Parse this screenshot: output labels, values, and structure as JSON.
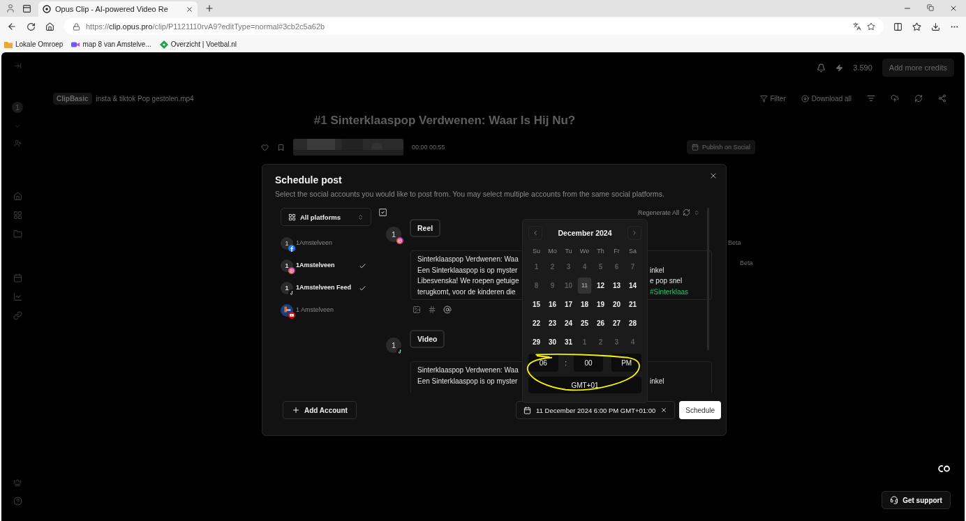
{
  "browser": {
    "tab_title": "Opus Clip - AI-powered Video Re",
    "url_scheme": "https://",
    "url_host": "clip.opus.pro",
    "url_path": "/clip/P1121110rvA9?editType=normal#3cb2c5a62b",
    "bookmarks": [
      {
        "label": "Lokale Omroep",
        "kind": "folder"
      },
      {
        "label": "map 8 van Amstelve...",
        "kind": "video"
      },
      {
        "label": "Overzicht | Voetbal.nl",
        "kind": "diamond"
      }
    ]
  },
  "app": {
    "credits": "3.590",
    "add_credits": "Add more credits",
    "project_count": "1",
    "plan": "ClipBasic",
    "filename": "insta & tiktok Pop gestolen.mp4",
    "filter": "Filter",
    "download_all": "Download all",
    "clip_number": "#1",
    "clip_title": "Sinterklaaspop Verdwenen: Waar Is Hij Nu?",
    "video_time": "00:00",
    "video_duration": "00:55",
    "publish": "Publish on Social",
    "beta_tags": [
      "Beta",
      "Beta"
    ],
    "support": "Get support"
  },
  "schedule": {
    "title": "Schedule post",
    "subtitle": "Select the social accounts you would like to post from. You may select multiple accounts from the same social platforms.",
    "platform_filter": "All platforms",
    "accounts": [
      {
        "name": "1Amstelveen",
        "avatar": "1",
        "kind": "facebook",
        "checked": false
      },
      {
        "name": "1Amstelveen",
        "avatar": "1",
        "kind": "instagram",
        "checked": true
      },
      {
        "name": "1Amstelveen Feed",
        "avatar": "1",
        "kind": "tiktok",
        "checked": true
      },
      {
        "name": "1 Amstelveen",
        "kind": "youtube",
        "checked": false
      }
    ],
    "regenerate": "Regenerate All",
    "posts": [
      {
        "avatar": "1",
        "kind": "instagram",
        "type": "Reel",
        "tools": true,
        "lines": [
          {
            "left": "Sinterklaaspop Verdwenen: Waa"
          },
          {
            "left": "Een Sinterklaaspop is op myster",
            "right": "inkel",
            "hashtag": false
          },
          {
            "left": "Libesvenska! We roepen getuige",
            "right": "e pop snel",
            "hashtag": false
          },
          {
            "left": "terugkomt, voor de kinderen die",
            "right": "#Sinterklaas",
            "hashtag": true
          }
        ]
      },
      {
        "avatar": "1",
        "kind": "tiktok",
        "type": "Video",
        "tools": false,
        "lines": [
          {
            "left": "Sinterklaaspop Verdwenen: Waa"
          },
          {
            "left": "Een Sinterklaaspop is op myster",
            "right": "inkel",
            "hashtag": false
          }
        ]
      }
    ],
    "calendar": {
      "month": "December 2024",
      "weekdays": [
        "Su",
        "Mo",
        "Tu",
        "We",
        "Th",
        "Fr",
        "Sa"
      ],
      "days": [
        {
          "label": "1",
          "muted": true,
          "selected": false
        },
        {
          "label": "2",
          "muted": true,
          "selected": false
        },
        {
          "label": "3",
          "muted": true,
          "selected": false
        },
        {
          "label": "4",
          "muted": true,
          "selected": false
        },
        {
          "label": "5",
          "muted": true,
          "selected": false
        },
        {
          "label": "6",
          "muted": true,
          "selected": false
        },
        {
          "label": "7",
          "muted": true,
          "selected": false
        },
        {
          "label": "8",
          "muted": true,
          "selected": false
        },
        {
          "label": "9",
          "muted": true,
          "selected": false
        },
        {
          "label": "10",
          "muted": true,
          "selected": false
        },
        {
          "label": "11",
          "muted": true,
          "selected": true
        },
        {
          "label": "12",
          "muted": false,
          "selected": false
        },
        {
          "label": "13",
          "muted": false,
          "selected": false
        },
        {
          "label": "14",
          "muted": false,
          "selected": false
        },
        {
          "label": "15",
          "muted": false,
          "selected": false
        },
        {
          "label": "16",
          "muted": false,
          "selected": false
        },
        {
          "label": "17",
          "muted": false,
          "selected": false
        },
        {
          "label": "18",
          "muted": false,
          "selected": false
        },
        {
          "label": "19",
          "muted": false,
          "selected": false
        },
        {
          "label": "20",
          "muted": false,
          "selected": false
        },
        {
          "label": "21",
          "muted": false,
          "selected": false
        },
        {
          "label": "22",
          "muted": false,
          "selected": false
        },
        {
          "label": "23",
          "muted": false,
          "selected": false
        },
        {
          "label": "24",
          "muted": false,
          "selected": false
        },
        {
          "label": "25",
          "muted": false,
          "selected": false
        },
        {
          "label": "26",
          "muted": false,
          "selected": false
        },
        {
          "label": "27",
          "muted": false,
          "selected": false
        },
        {
          "label": "28",
          "muted": false,
          "selected": false
        },
        {
          "label": "29",
          "muted": false,
          "selected": false
        },
        {
          "label": "30",
          "muted": false,
          "selected": false
        },
        {
          "label": "31",
          "muted": false,
          "selected": false
        },
        {
          "label": "1",
          "muted": true,
          "selected": false
        },
        {
          "label": "2",
          "muted": true,
          "selected": false
        },
        {
          "label": "3",
          "muted": true,
          "selected": false
        },
        {
          "label": "4",
          "muted": true,
          "selected": false
        }
      ],
      "hour": "06",
      "separator": ":",
      "minute": "00",
      "period": "PM",
      "timezone": "GMT+01"
    },
    "add_account": "Add Account",
    "date": "11 December 2024 6:00 PM GMT+01:00",
    "schedule_button": "Schedule"
  }
}
